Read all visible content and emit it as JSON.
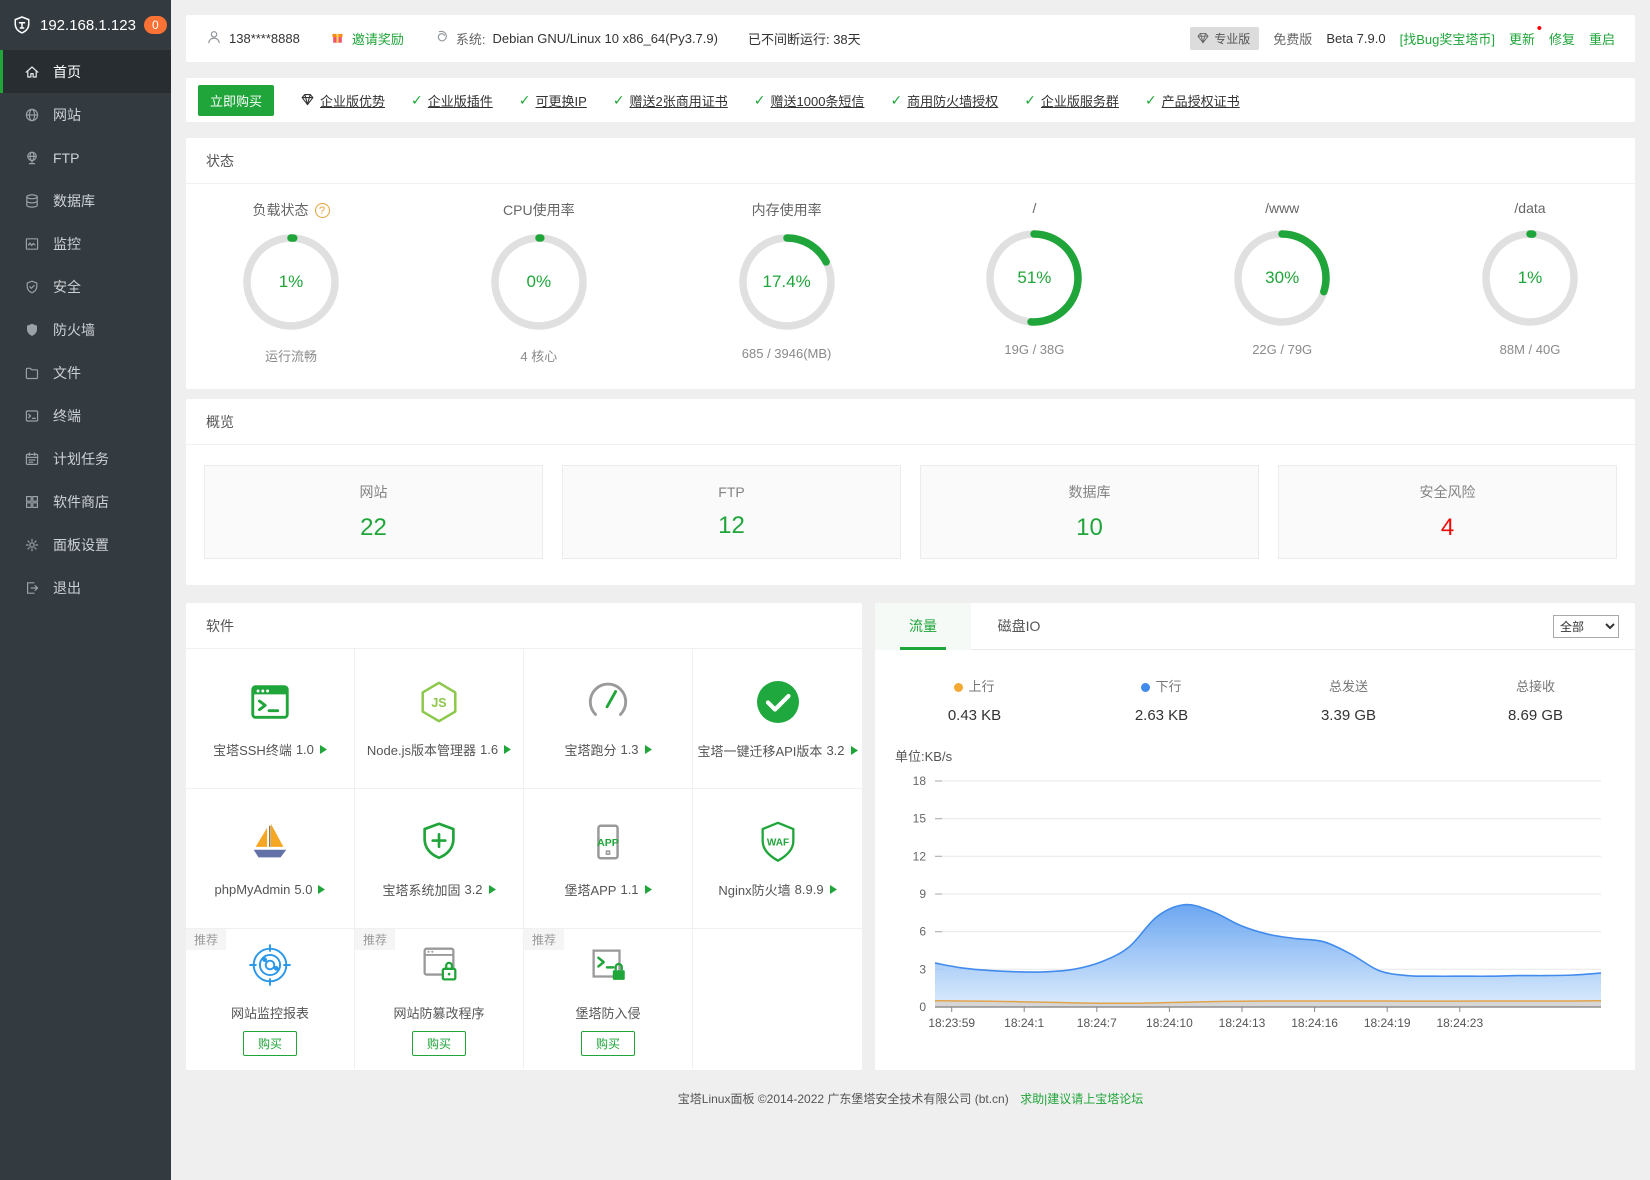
{
  "colors": {
    "green": "#20a53a",
    "red": "#ef0808",
    "sidebar_bg": "#333a40",
    "badge_orange": "#fb7234",
    "chart_down_blue": "#418bec",
    "chart_up_orange": "#e2a34b",
    "up_dot": "#f5a935"
  },
  "sidebar": {
    "server_ip": "192.168.1.123",
    "badge_count": "0",
    "items": [
      {
        "label": "首页",
        "icon": "home-icon"
      },
      {
        "label": "网站",
        "icon": "globe-icon"
      },
      {
        "label": "FTP",
        "icon": "ftp-icon"
      },
      {
        "label": "数据库",
        "icon": "database-icon"
      },
      {
        "label": "监控",
        "icon": "monitor-icon"
      },
      {
        "label": "安全",
        "icon": "security-icon"
      },
      {
        "label": "防火墙",
        "icon": "firewall-icon"
      },
      {
        "label": "文件",
        "icon": "files-icon"
      },
      {
        "label": "终端",
        "icon": "terminal-icon"
      },
      {
        "label": "计划任务",
        "icon": "cron-icon"
      },
      {
        "label": "软件商店",
        "icon": "appstore-icon"
      },
      {
        "label": "面板设置",
        "icon": "settings-icon"
      },
      {
        "label": "退出",
        "icon": "logout-icon"
      }
    ]
  },
  "topbar": {
    "user_phone": "138****8888",
    "invite_label": "邀请奖励",
    "system_label": "系统:",
    "system_value": "Debian GNU/Linux 10 x86_64(Py3.7.9)",
    "uptime": "已不间断运行: 38天",
    "pro_badge": "专业版",
    "free_label": "免费版",
    "version": "Beta 7.9.0",
    "bug_link": "[找Bug奖宝塔币]",
    "update_label": "更新",
    "repair_label": "修复",
    "restart_label": "重启"
  },
  "promo": {
    "buy_button": "立即购买",
    "enterprise_label": "企业版优势",
    "features": [
      "企业版插件",
      "可更换IP",
      "赠送2张商用证书",
      "赠送1000条短信",
      "商用防火墙授权",
      "企业版服务群",
      "产品授权证书"
    ]
  },
  "status": {
    "title": "状态",
    "gauges": [
      {
        "title": "负载状态",
        "has_help": true,
        "percent": 1,
        "value": "1%",
        "subtitle": "运行流畅"
      },
      {
        "title": "CPU使用率",
        "percent": 0,
        "value": "0%",
        "subtitle": "4 核心"
      },
      {
        "title": "内存使用率",
        "percent": 17.4,
        "value": "17.4%",
        "subtitle": "685 / 3946(MB)"
      },
      {
        "title": "/",
        "percent": 51,
        "value": "51%",
        "subtitle": "19G / 38G"
      },
      {
        "title": "/www",
        "percent": 30,
        "value": "30%",
        "subtitle": "22G / 79G"
      },
      {
        "title": "/data",
        "percent": 1,
        "value": "1%",
        "subtitle": "88M / 40G"
      }
    ]
  },
  "overview": {
    "title": "概览",
    "cards": [
      {
        "label": "网站",
        "value": "22",
        "color": "green"
      },
      {
        "label": "FTP",
        "value": "12",
        "color": "green"
      },
      {
        "label": "数据库",
        "value": "10",
        "color": "green"
      },
      {
        "label": "安全风险",
        "value": "4",
        "color": "red"
      }
    ]
  },
  "software": {
    "title": "软件",
    "items": [
      {
        "name": "宝塔SSH终端",
        "version": "1.0",
        "icon": "ssh-terminal-icon"
      },
      {
        "name": "Node.js版本管理器",
        "version": "1.6",
        "icon": "nodejs-icon"
      },
      {
        "name": "宝塔跑分",
        "version": "1.3",
        "icon": "benchmark-icon"
      },
      {
        "name": "宝塔一键迁移API版本",
        "version": "3.2",
        "icon": "migrate-icon"
      },
      {
        "name": "phpMyAdmin",
        "version": "5.0",
        "icon": "phpmyadmin-icon"
      },
      {
        "name": "宝塔系统加固",
        "version": "3.2",
        "icon": "harden-icon"
      },
      {
        "name": "堡塔APP",
        "version": "1.1",
        "icon": "app-icon"
      },
      {
        "name": "Nginx防火墙",
        "version": "8.9.9",
        "icon": "waf-icon"
      },
      {
        "name": "网站监控报表",
        "icon": "monitor-report-icon",
        "recommend": "推荐",
        "buy": "购买"
      },
      {
        "name": "网站防篡改程序",
        "icon": "tamper-proof-icon",
        "recommend": "推荐",
        "buy": "购买"
      },
      {
        "name": "堡塔防入侵",
        "icon": "intrusion-icon",
        "recommend": "推荐",
        "buy": "购买"
      }
    ]
  },
  "traffic": {
    "tabs": [
      "流量",
      "磁盘IO"
    ],
    "active_tab": "流量",
    "filter_value": "全部",
    "stats": [
      {
        "label": "上行",
        "value": "0.43 KB",
        "dot": "#f5a935"
      },
      {
        "label": "下行",
        "value": "2.63 KB",
        "dot": "#418bec"
      },
      {
        "label": "总发送",
        "value": "3.39 GB"
      },
      {
        "label": "总接收",
        "value": "8.69 GB"
      }
    ]
  },
  "chart_data": {
    "type": "area",
    "unit_label": "单位:KB/s",
    "ylim": [
      0,
      18
    ],
    "yticks": [
      0,
      3,
      6,
      9,
      12,
      15,
      18
    ],
    "xticks": [
      "18:23:59",
      "18:24:1",
      "18:24:7",
      "18:24:10",
      "18:24:13",
      "18:24:16",
      "18:24:19",
      "18:24:23"
    ],
    "legend_position": "top",
    "grid": true,
    "series": [
      {
        "name": "下行",
        "color": "#418bec",
        "fill": "blue-gradient",
        "values": [
          3.5,
          3.1,
          2.9,
          2.8,
          2.8,
          3.0,
          3.6,
          4.8,
          7.2,
          8.15,
          7.6,
          6.5,
          5.8,
          5.45,
          5.2,
          4.2,
          2.9,
          2.5,
          2.45,
          2.45,
          2.45,
          2.5,
          2.5,
          2.55,
          2.7
        ]
      },
      {
        "name": "上行",
        "color": "#e2a34b",
        "fill": "#d6d6d6",
        "values": [
          0.5,
          0.48,
          0.45,
          0.42,
          0.38,
          0.33,
          0.3,
          0.3,
          0.33,
          0.38,
          0.43,
          0.46,
          0.48,
          0.48,
          0.48,
          0.48,
          0.48,
          0.47,
          0.47,
          0.47,
          0.48,
          0.48,
          0.48,
          0.48,
          0.5
        ]
      }
    ]
  },
  "footer": {
    "text": "宝塔Linux面板 ©2014-2022 广东堡塔安全技术有限公司 (bt.cn)",
    "link": "求助|建议请上宝塔论坛"
  }
}
